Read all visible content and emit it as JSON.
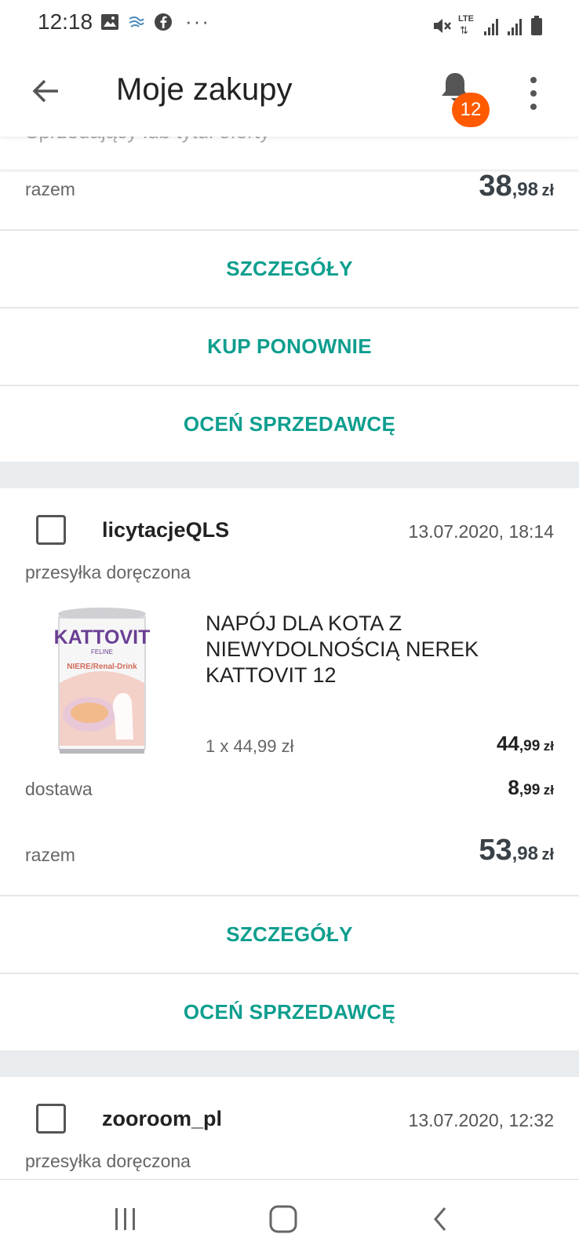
{
  "status_bar": {
    "time": "12:18",
    "icons_left": [
      "image-icon",
      "wind-icon",
      "facebook-icon",
      "more-icon"
    ],
    "icons_right": [
      "mute-icon",
      "lte-icon",
      "signal-icon",
      "signal-icon",
      "battery-icon"
    ],
    "lte_label": "LTE",
    "more_label": "···"
  },
  "header": {
    "title": "Moje zakupy",
    "notification_count": "12"
  },
  "search": {
    "placeholder": "Sprzedający lub tytuł oferty"
  },
  "order_top": {
    "total_label": "razem",
    "total_main": "38",
    "total_decimal": ",98",
    "total_currency": "zł",
    "actions": [
      "SZCZEGÓŁY",
      "KUP PONOWNIE",
      "OCEŃ SPRZEDAWCĘ"
    ]
  },
  "order_2": {
    "seller": "licytacjeQLS",
    "date": "13.07.2020, 18:14",
    "status": "przesyłka doręczona",
    "product": {
      "title": "NAPÓJ DLA KOTA Z NIEWYDOLNOŚCIĄ NEREK KATTOVIT 12",
      "quantity_line": "1 x 44,99 zł",
      "price_main": "44",
      "price_decimal": ",99",
      "price_currency": "zł",
      "image_text_brand": "KATTOVIT",
      "image_text_sub": "FELINE",
      "image_text_variant": "NIERE/Renal-Drink"
    },
    "delivery_label": "dostawa",
    "delivery_main": "8",
    "delivery_decimal": ",99",
    "delivery_currency": "zł",
    "total_label": "razem",
    "total_main": "53",
    "total_decimal": ",98",
    "total_currency": "zł",
    "actions": [
      "SZCZEGÓŁY",
      "OCEŃ SPRZEDAWCĘ"
    ]
  },
  "order_3": {
    "seller": "zooroom_pl",
    "date": "13.07.2020, 12:32",
    "status": "przesyłka doręczona"
  },
  "colors": {
    "accent": "#0e9e8e",
    "badge": "#ff5a00",
    "background": "#e8ecee"
  }
}
